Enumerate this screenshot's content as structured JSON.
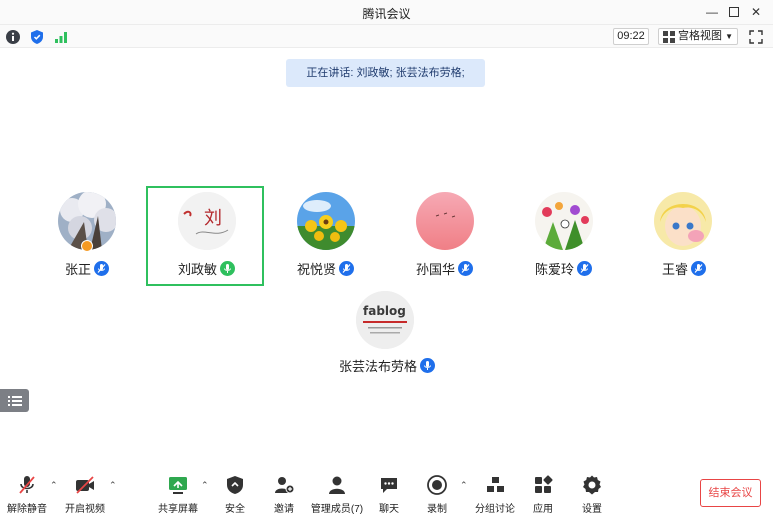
{
  "window": {
    "title": "腾讯会议"
  },
  "infobar": {
    "time": "09:22",
    "view_label": "宫格视图"
  },
  "speaking_text": "正在讲话: 刘政敏; 张芸法布劳格;",
  "participants": [
    {
      "name": "张正",
      "host": true,
      "mic": "muted"
    },
    {
      "name": "刘政敏",
      "host": false,
      "mic": "speaking",
      "avatar_text": "刘"
    },
    {
      "name": "祝悦贤",
      "host": false,
      "mic": "muted"
    },
    {
      "name": "孙国华",
      "host": false,
      "mic": "muted"
    },
    {
      "name": "陈爱玲",
      "host": false,
      "mic": "muted"
    },
    {
      "name": "王睿",
      "host": false,
      "mic": "muted"
    },
    {
      "name": "张芸法布劳格",
      "host": false,
      "mic": "speaking",
      "avatar_text": "fablog"
    }
  ],
  "toolbar": {
    "unmute": "解除静音",
    "start_video": "开启视频",
    "share_screen": "共享屏幕",
    "security": "安全",
    "invite": "邀请",
    "manage_members": "管理成员(7)",
    "chat": "聊天",
    "record": "录制",
    "breakout": "分组讨论",
    "apps": "应用",
    "settings": "设置",
    "end_meeting": "结束会议"
  },
  "colors": {
    "accent_blue": "#1f6feb",
    "active_green": "#2fc05e",
    "end_red": "#e84545"
  }
}
